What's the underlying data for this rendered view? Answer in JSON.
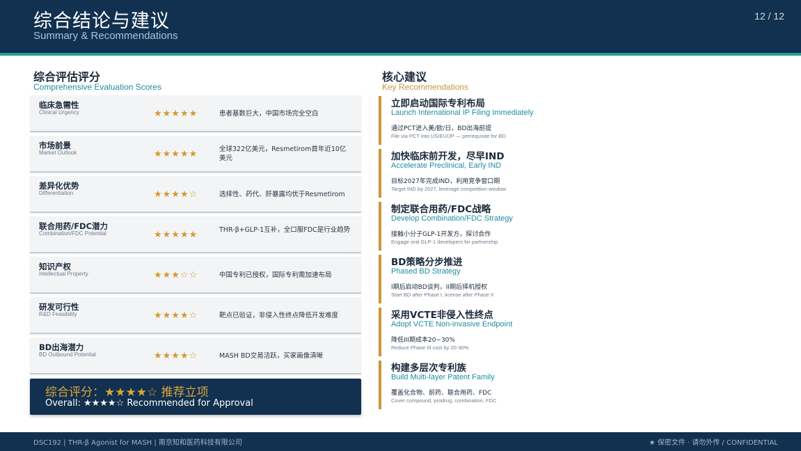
{
  "header": {
    "title": "综合结论与建议",
    "subtitle": "Summary & Recommendations",
    "page": "12 / 12"
  },
  "scores": {
    "title": "综合评估评分",
    "subtitle": "Comprehensive Evaluation Scores",
    "items": [
      {
        "name": "临床急需性",
        "name_en": "Clinical Urgency",
        "stars": "★★★★★",
        "rating": 5,
        "desc": "患者基数巨大，中国市场完全空白"
      },
      {
        "name": "市场前景",
        "name_en": "Market Outlook",
        "stars": "★★★★★",
        "rating": 5,
        "desc": "全球322亿美元，Resmetirom首年近10亿美元"
      },
      {
        "name": "差异化优势",
        "name_en": "Differentiation",
        "stars": "★★★★☆",
        "rating": 4,
        "desc": "选择性、药代、肝暴露均优于Resmetirom"
      },
      {
        "name": "联合用药/FDC潜力",
        "name_en": "Combination/FDC Potential",
        "stars": "★★★★★",
        "rating": 5,
        "desc": "THR-β+GLP-1互补，全口服FDC是行业趋势"
      },
      {
        "name": "知识产权",
        "name_en": "Intellectual Property",
        "stars": "★★★☆☆",
        "rating": 3,
        "desc": "中国专利已授权，国际专利需加速布局"
      },
      {
        "name": "研发可行性",
        "name_en": "R&D Feasibility",
        "stars": "★★★★☆",
        "rating": 4,
        "desc": "靶点已验证，非侵入性终点降低开发难度"
      },
      {
        "name": "BD出海潜力",
        "name_en": "BD Outbound Potential",
        "stars": "★★★★☆",
        "rating": 4,
        "desc": "MASH BD交易活跃，买家画像清晰"
      }
    ],
    "overall_cn": "综合评分：★★★★☆  推荐立项",
    "overall_en": "Overall: ★★★★☆  Recommended for Approval"
  },
  "recommendations": {
    "title": "核心建议",
    "subtitle": "Key Recommendations",
    "items": [
      {
        "title": "立即启动国际专利布局",
        "subtitle": "Launch International IP Filing Immediately",
        "desc": "通过PCT进入美/欧/日，BD出海前提",
        "desc_en": "File via PCT into US/EU/JP — prerequisite for BD"
      },
      {
        "title": "加快临床前开发，尽早IND",
        "subtitle": "Accelerate Preclinical, Early IND",
        "desc": "目标2027年完成IND，利用竞争窗口期",
        "desc_en": "Target IND by 2027, leverage competition window"
      },
      {
        "title": "制定联合用药/FDC战略",
        "subtitle": "Develop Combination/FDC Strategy",
        "desc": "接触小分子GLP-1开发方，探讨合作",
        "desc_en": "Engage oral GLP-1 developers for partnership"
      },
      {
        "title": "BD策略分步推进",
        "subtitle": "Phased BD Strategy",
        "desc": "I期后启动BD谈判，II期后择机授权",
        "desc_en": "Start BD after Phase I, license after Phase II"
      },
      {
        "title": "采用VCTE非侵入性终点",
        "subtitle": "Adopt VCTE Non-invasive Endpoint",
        "desc": "降低III期成本20~30%",
        "desc_en": "Reduce Phase III cost by 20-30%"
      },
      {
        "title": "构建多层次专利族",
        "subtitle": "Build Multi-layer Patent Family",
        "desc": "覆盖化合物、前药、联合用药、FDC",
        "desc_en": "Cover compound, prodrug, combination, FDC"
      }
    ]
  },
  "footer": {
    "left": "DSC192 | THR-β Agonist for MASH | 南京知和医药科技有限公司",
    "right": "★ 保密文件 · 请勿外传 / CONFIDENTIAL"
  },
  "colors": {
    "navy": "#12304f",
    "teal": "#1e8c9e",
    "gold": "#c99638",
    "star": "#d29a2e"
  }
}
